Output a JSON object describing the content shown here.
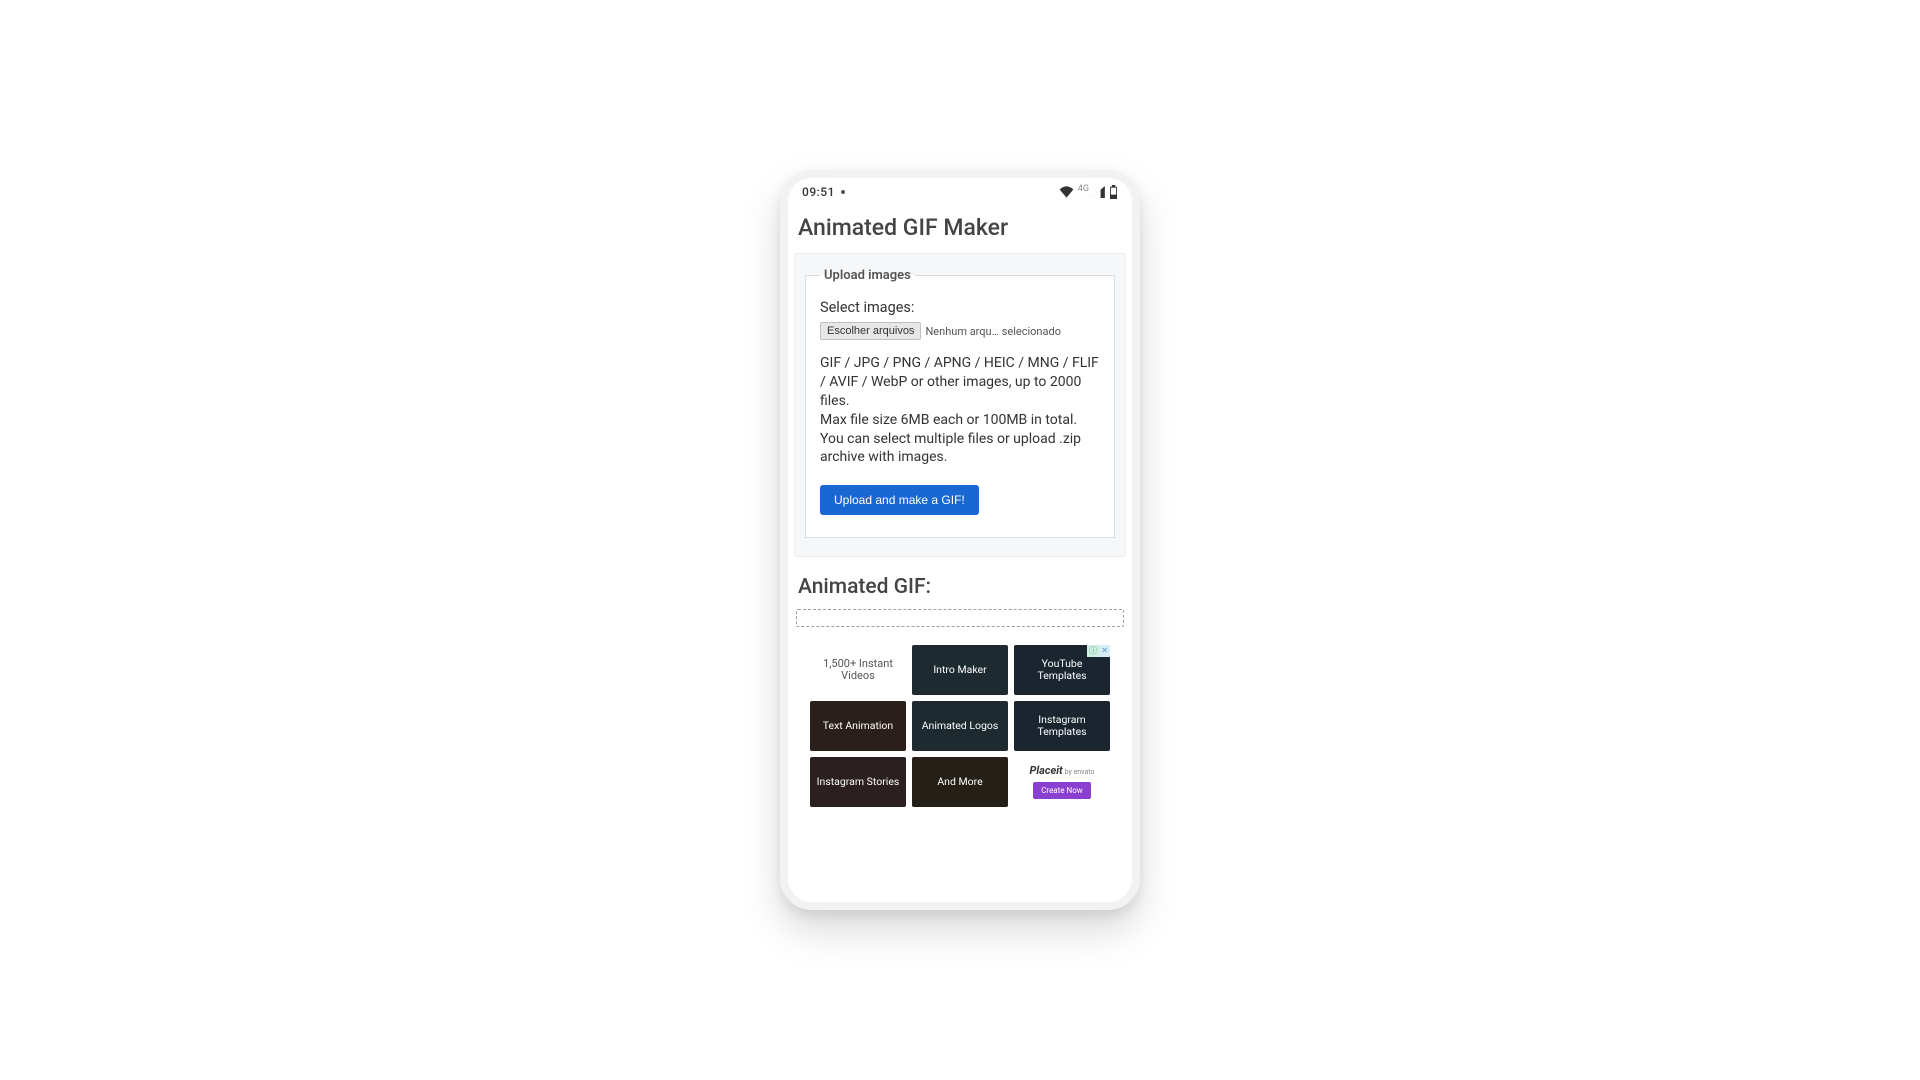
{
  "status": {
    "time": "09:51",
    "network_label": "4G"
  },
  "page": {
    "title": "Animated GIF Maker"
  },
  "upload": {
    "legend": "Upload images",
    "select_label": "Select images:",
    "file_button": "Escolher arquivos",
    "file_status": "Nenhum arqu… selecionado",
    "hint_line1": "GIF / JPG / PNG / APNG / HEIC / MNG / FLIF / AVIF / WebP or other images, up to 2000 files.",
    "hint_line2": "Max file size 6MB each or 100MB in total.",
    "hint_line3": "You can select multiple files or upload .zip archive with images.",
    "submit_label": "Upload and make a GIF!"
  },
  "output": {
    "title": "Animated GIF:"
  },
  "ad": {
    "badge_i": "ⓘ",
    "badge_x": "✕",
    "cells": [
      "1,500+ Instant Videos",
      "Intro Maker",
      "YouTube Templates",
      "Text Animation",
      "Animated Logos",
      "Instagram Templates",
      "Instagram Stories",
      "And More"
    ],
    "brand": "Placeit",
    "brand_by": "by envato",
    "cta": "Create Now"
  }
}
